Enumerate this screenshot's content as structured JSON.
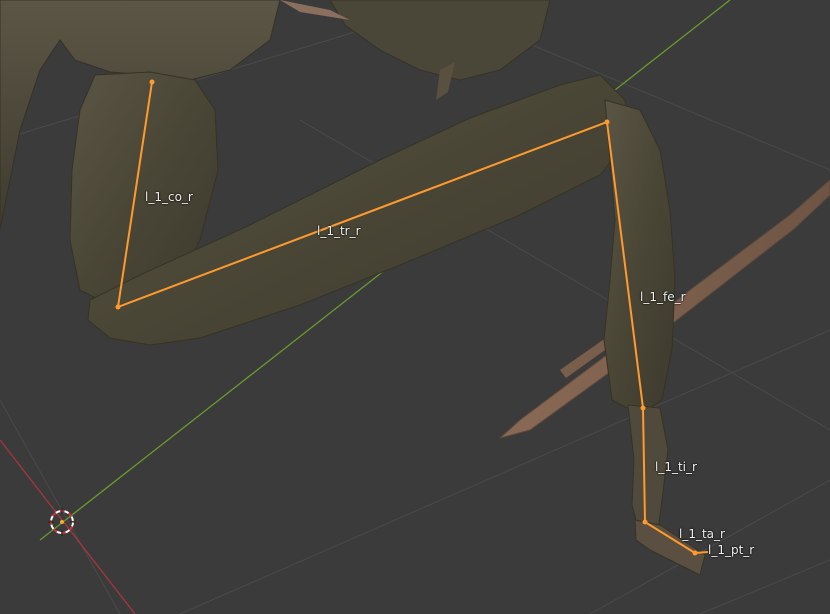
{
  "viewport": {
    "background": "#3b3b3b",
    "grid_color": "#474747",
    "x_axis_color": "#a8353f",
    "y_axis_color": "#6a9a2b",
    "bone_color": "#ff9a2e",
    "mesh_color": "#4a4636"
  },
  "bones": {
    "co": "l_1_co_r",
    "tr": "l_1_tr_r",
    "fe": "l_1_fe_r",
    "ti": "l_1_ti_r",
    "ta": "l_1_ta_r",
    "pt": "l_1_pt_r"
  },
  "icons": {
    "cursor": "3d-cursor-icon"
  }
}
